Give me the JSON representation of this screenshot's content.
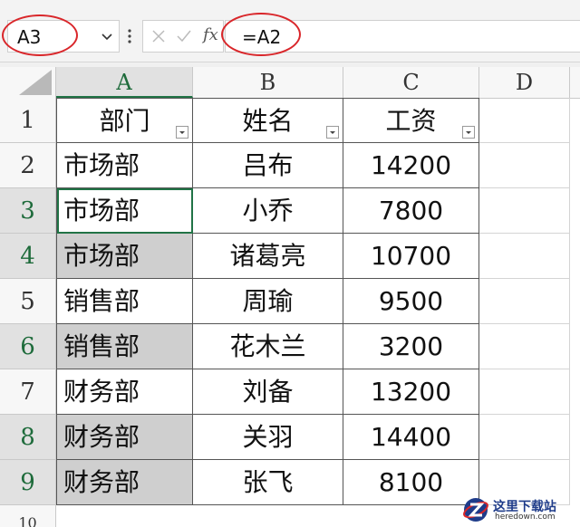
{
  "formula_bar": {
    "name_box_value": "A3",
    "fx_label": "fx",
    "formula_value": "=A2"
  },
  "columns": [
    "A",
    "B",
    "C",
    "D"
  ],
  "selected_column": "A",
  "rows": [
    "1",
    "2",
    "3",
    "4",
    "5",
    "6",
    "7",
    "8",
    "9",
    "10"
  ],
  "selected_rows": [
    "3",
    "4",
    "6",
    "8",
    "9"
  ],
  "table": {
    "headers": [
      "部门",
      "姓名",
      "工资"
    ],
    "data": [
      [
        "市场部",
        "吕布",
        "14200"
      ],
      [
        "市场部",
        "小乔",
        "7800"
      ],
      [
        "市场部",
        "诸葛亮",
        "10700"
      ],
      [
        "销售部",
        "周瑜",
        "9500"
      ],
      [
        "销售部",
        "花木兰",
        "3200"
      ],
      [
        "财务部",
        "刘备",
        "13200"
      ],
      [
        "财务部",
        "关羽",
        "14400"
      ],
      [
        "财务部",
        "张飞",
        "8100"
      ]
    ]
  },
  "active_cell": "A3",
  "highlight_color": "#d9262a",
  "accent_color": "#217346",
  "watermark": {
    "title": "这里下载站",
    "url": "heredown.com"
  },
  "icons": [
    "chevron-down-icon",
    "more-vertical-icon",
    "cancel-icon",
    "confirm-icon",
    "fx-icon",
    "select-all-icon",
    "filter-dropdown-icon"
  ]
}
